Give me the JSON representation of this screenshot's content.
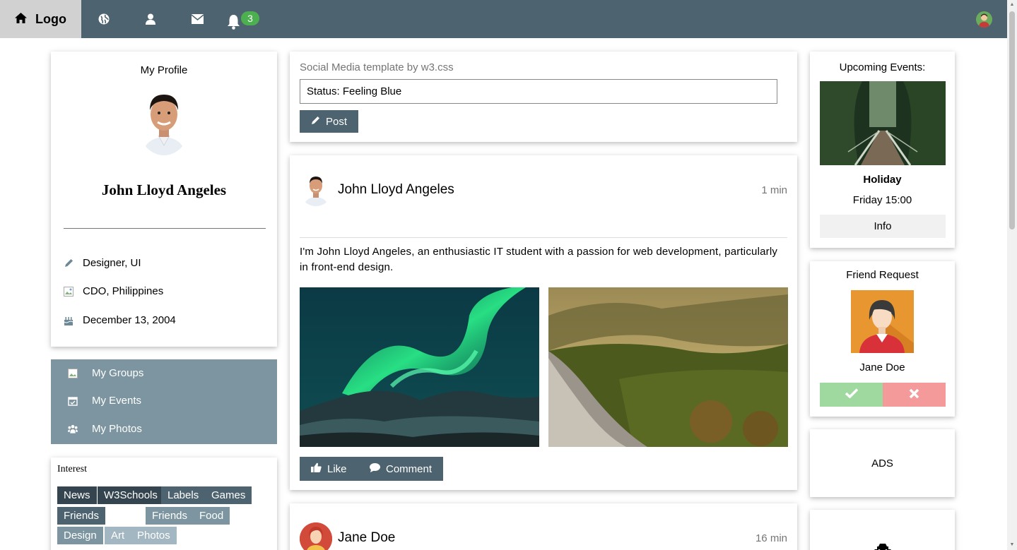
{
  "topbar": {
    "logo_label": "Logo",
    "icons": [
      "home-icon",
      "globe-icon",
      "user-icon",
      "envelope-icon",
      "bell-icon"
    ],
    "notification_count": "3"
  },
  "profile": {
    "heading": "My Profile",
    "name": "John Lloyd Angeles",
    "job": "Designer, UI",
    "location": "CDO, Philippines",
    "birthday": "December 13, 2004"
  },
  "accordion": {
    "items": [
      {
        "label": "My Groups",
        "icon": "users-icon"
      },
      {
        "label": "My Events",
        "icon": "calendar-icon"
      },
      {
        "label": "My Photos",
        "icon": "users-icon"
      }
    ]
  },
  "interest": {
    "title": "Interest",
    "tags": [
      "News",
      "W3Schools",
      "Labels",
      "Games",
      "Friends",
      "Friends",
      "Food",
      "Design",
      "Art",
      "Photos"
    ]
  },
  "status": {
    "subtitle": "Social Media template by w3.css",
    "value": "Status: Feeling Blue",
    "post_label": "Post"
  },
  "posts": [
    {
      "author": "John Lloyd Angeles",
      "time": "1 min",
      "text": "I'm John Lloyd Angeles, an enthusiastic IT student with a passion for web development, particularly in front-end design.",
      "like_label": "Like",
      "comment_label": "Comment"
    },
    {
      "author": "Jane Doe",
      "time": "16 min"
    }
  ],
  "events": {
    "heading": "Upcoming Events:",
    "name": "Holiday",
    "date": "Friday 15:00",
    "info_label": "Info"
  },
  "friend_request": {
    "heading": "Friend Request",
    "name": "Jane Doe"
  },
  "ads": {
    "label": "ADS"
  },
  "colors": {
    "topbar": "#4d636f",
    "accordion": "#7c95a1",
    "accept": "#9fd99f",
    "decline": "#f59a9a",
    "badge": "#4caf50"
  }
}
